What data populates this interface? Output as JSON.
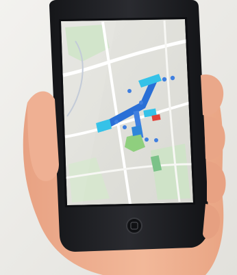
{
  "scene": {
    "subject": "hand-holding-phone",
    "phone_color": "#1f2024",
    "background_color": "#ecebe7"
  },
  "map": {
    "land_color": "#dcdcd6",
    "route_color": "#2a6fd6",
    "highlight_color": "#35c2e8",
    "green_area_color": "#8fcf7e",
    "pin_color": "#3f7fe0",
    "parking_color": "#e3423a"
  }
}
